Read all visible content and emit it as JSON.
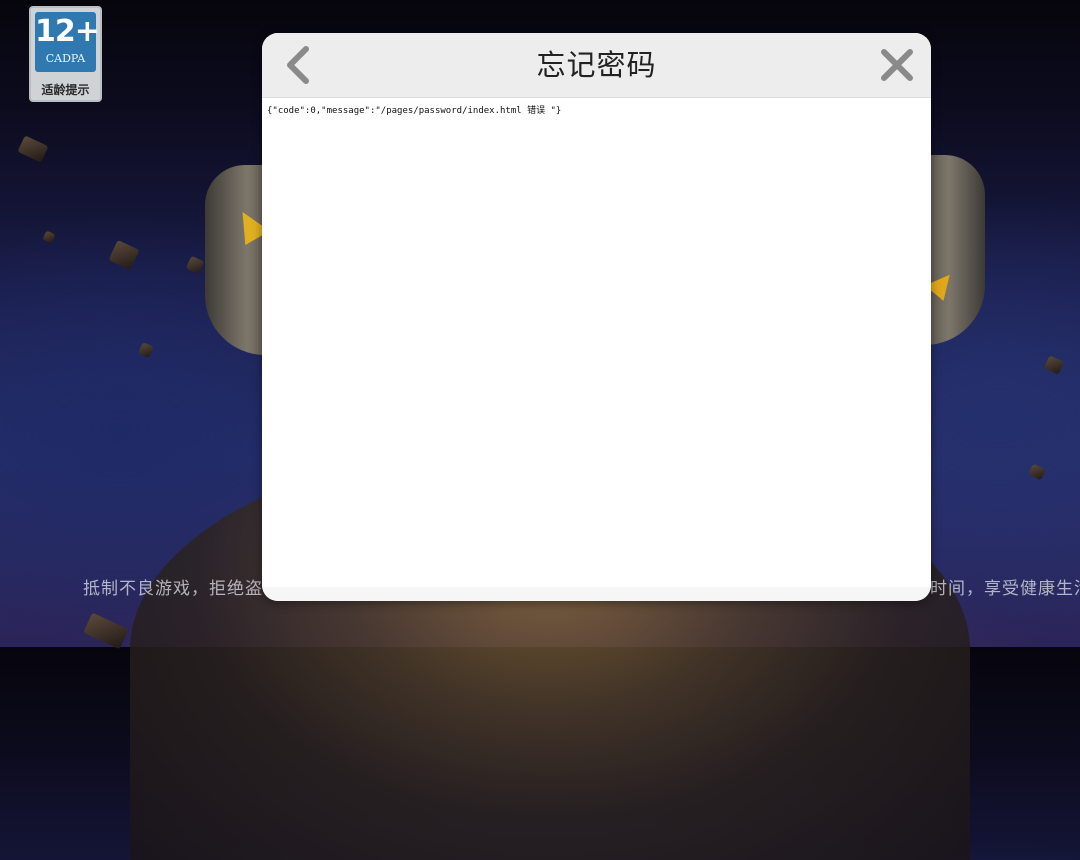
{
  "age_rating": {
    "number": "12+",
    "org": "CADPA",
    "tip": "适龄提示"
  },
  "ticker": {
    "left_text": "抵制不良游戏，拒绝盗",
    "right_text": "时间，享受健康生活"
  },
  "dialog": {
    "title": "忘记密码",
    "back_icon": "chevron-left-icon",
    "close_icon": "close-icon",
    "body_text": "{\"code\":0,\"message\":\"/pages/password/index.html 错误 \"}"
  }
}
